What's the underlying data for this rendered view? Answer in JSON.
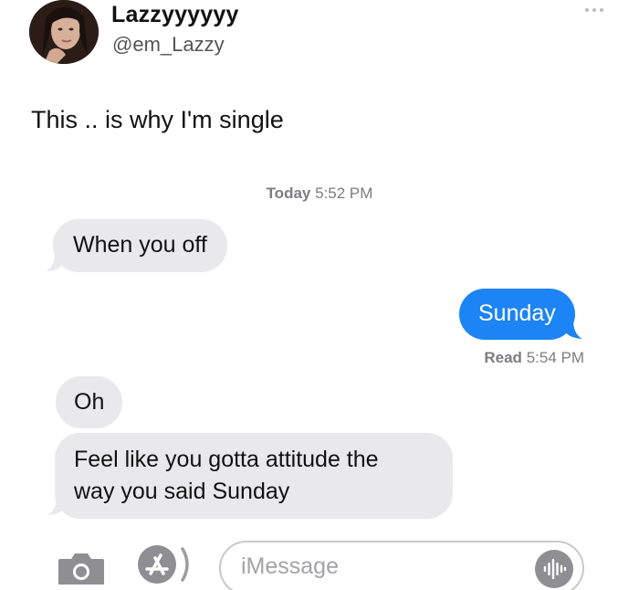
{
  "tweet": {
    "display_name": "Lazzyyyyyy",
    "handle": "@em_Lazzy",
    "text": "This .. is why I'm single"
  },
  "conversation": {
    "timestamp_day": "Today",
    "timestamp_time": "5:52 PM",
    "messages": [
      {
        "direction": "incoming",
        "text": "When you off"
      },
      {
        "direction": "outgoing",
        "text": "Sunday"
      },
      {
        "direction": "incoming",
        "text": "Oh"
      },
      {
        "direction": "incoming",
        "text_line1": "Feel like you gotta attitude the",
        "text_line2": "way you said Sunday"
      }
    ],
    "read_label": "Read",
    "read_time": "5:54 PM"
  },
  "composer": {
    "placeholder": "iMessage"
  },
  "icons": {
    "more": "more-horizontal-icon",
    "camera": "camera-icon",
    "app_store": "app-store-icon",
    "audio": "audio-waveform-icon"
  },
  "colors": {
    "outgoing_bubble": "#1d84f5",
    "incoming_bubble": "#e9e9eb",
    "meta_text": "#7d7d82"
  }
}
